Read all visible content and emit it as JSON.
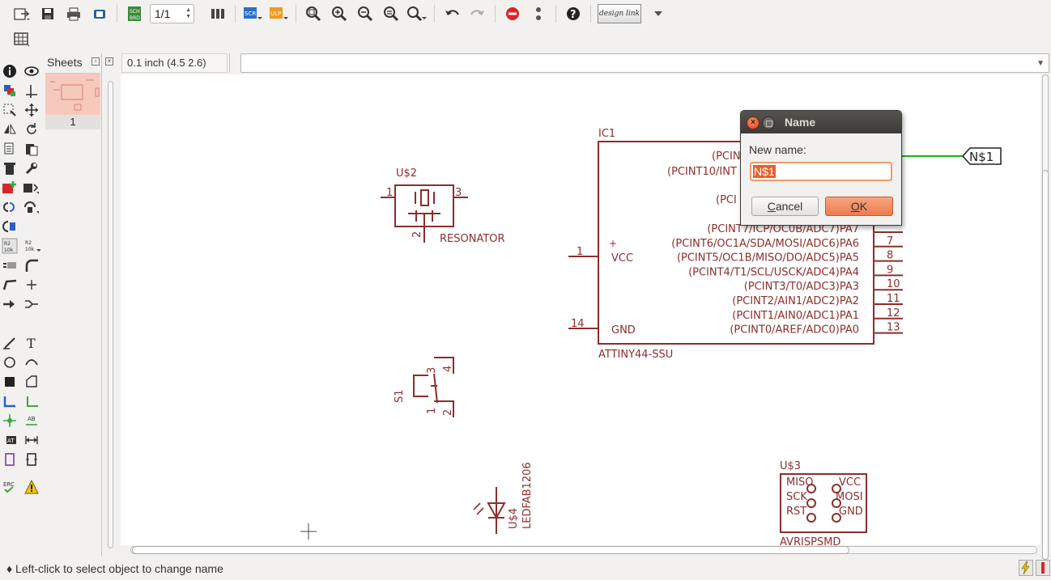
{
  "toolbar": {
    "sheet_selector": "1/1",
    "design_link_logo": "design link",
    "icons": [
      "open-icon",
      "save-icon",
      "print-icon",
      "cam-icon",
      "sch-brd-icon",
      "sheet-spinner",
      "layer-icon",
      "script-icon",
      "ulp-icon",
      "zoom-fit-icon",
      "zoom-in-icon",
      "zoom-out-icon",
      "zoom-redraw-icon",
      "zoom-select-icon",
      "undo-icon",
      "redo-icon",
      "stop-icon",
      "more-icon",
      "help-icon",
      "design-link-logo",
      "dropdown-arrow-icon"
    ]
  },
  "row2": {
    "icons": [
      "grid-icon"
    ]
  },
  "sheets_panel": {
    "title": "Sheets",
    "sheet_number": "1"
  },
  "grid_info": "0.1 inch (4.5 2.6)",
  "command_line": {
    "value": ""
  },
  "schematic": {
    "wire_color": "#1bb21b",
    "part_color": "#8c2e2c",
    "ic1": {
      "name": "IC1",
      "value": "ATTINY44-SSU",
      "left_pins": [
        {
          "num": "1",
          "name": "VCC"
        },
        {
          "num": "14",
          "name": "GND"
        }
      ],
      "right_pins_top": [
        "(PCIN",
        "(PCINT10/INT",
        "(PCI"
      ],
      "right_pins": [
        {
          "name": "(PCINT7/ICP/OC0B/ADC7)PA7",
          "num": ""
        },
        {
          "name": "(PCINT6/OC1A/SDA/MOSI/ADC6)PA6",
          "num": "7"
        },
        {
          "name": "(PCINT5/OC1B/MISO/DO/ADC5)PA5",
          "num": "8"
        },
        {
          "name": "(PCINT4/T1/SCL/USCK/ADC4)PA4",
          "num": "9"
        },
        {
          "name": "(PCINT3/T0/ADC3)PA3",
          "num": "10"
        },
        {
          "name": "(PCINT2/AIN1/ADC2)PA2",
          "num": "11"
        },
        {
          "name": "(PCINT1/AIN0/ADC1)PA1",
          "num": "12"
        },
        {
          "name": "(PCINT0/AREF/ADC0)PA0",
          "num": "13"
        }
      ]
    },
    "net_label": "N$1",
    "u2": {
      "name": "U$2",
      "value": "RESONATOR",
      "pin1": "1",
      "pin2": "2",
      "pin3": "3"
    },
    "s1": {
      "name": "S1",
      "pins": [
        "1",
        "2",
        "3",
        "4"
      ]
    },
    "u4": {
      "name": "U$4",
      "value": "LEDFAB1206"
    },
    "u3": {
      "name": "U$3",
      "value": "AVRISPSMD",
      "pins_left": [
        "MISO",
        "SCK",
        "RST"
      ],
      "pins_right": [
        "VCC",
        "MOSI",
        "GND"
      ]
    }
  },
  "dialog": {
    "title": "Name",
    "label": "New name:",
    "input_value": "N$1",
    "cancel_label": "Cancel",
    "ok_label": "OK",
    "dialog_title_bg": "#3c3b37",
    "ok_color": "#ec7b4e"
  },
  "status": {
    "message": "Left-click to select object to change name",
    "status_icons": [
      "lightning-icon",
      "stop-sign-icon"
    ]
  }
}
